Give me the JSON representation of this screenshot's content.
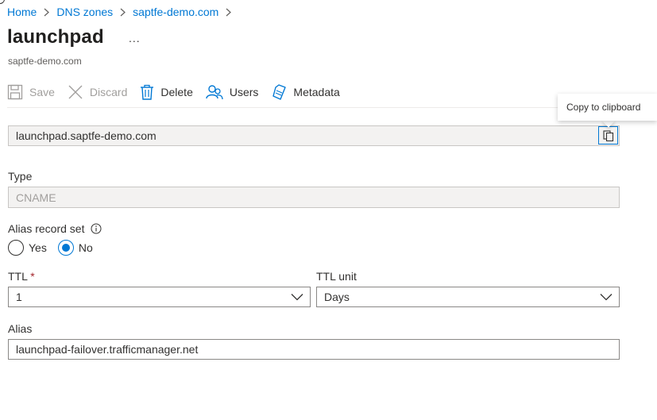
{
  "breadcrumb": {
    "items": [
      "Home",
      "DNS zones",
      "saptfe-demo.com"
    ]
  },
  "page": {
    "title": "launchpad",
    "more_label": "...",
    "subtitle": "saptfe-demo.com"
  },
  "toolbar": {
    "save_label": "Save",
    "discard_label": "Discard",
    "delete_label": "Delete",
    "users_label": "Users",
    "metadata_label": "Metadata"
  },
  "fqdn": {
    "value": "launchpad.saptfe-demo.com",
    "tooltip": "Copy to clipboard"
  },
  "type": {
    "label": "Type",
    "value": "CNAME"
  },
  "alias_record_set": {
    "label": "Alias record set",
    "options": [
      "Yes",
      "No"
    ],
    "selected": "No"
  },
  "ttl": {
    "label": "TTL",
    "required_mark": "*",
    "value": "1"
  },
  "ttl_unit": {
    "label": "TTL unit",
    "value": "Days"
  },
  "alias": {
    "label": "Alias",
    "value": "launchpad-failover.trafficmanager.net"
  },
  "colors": {
    "link": "#0078d4",
    "text": "#323130",
    "disabled_text": "#a19f9d",
    "required": "#a4262c",
    "readonly_bg": "#f3f2f1"
  }
}
